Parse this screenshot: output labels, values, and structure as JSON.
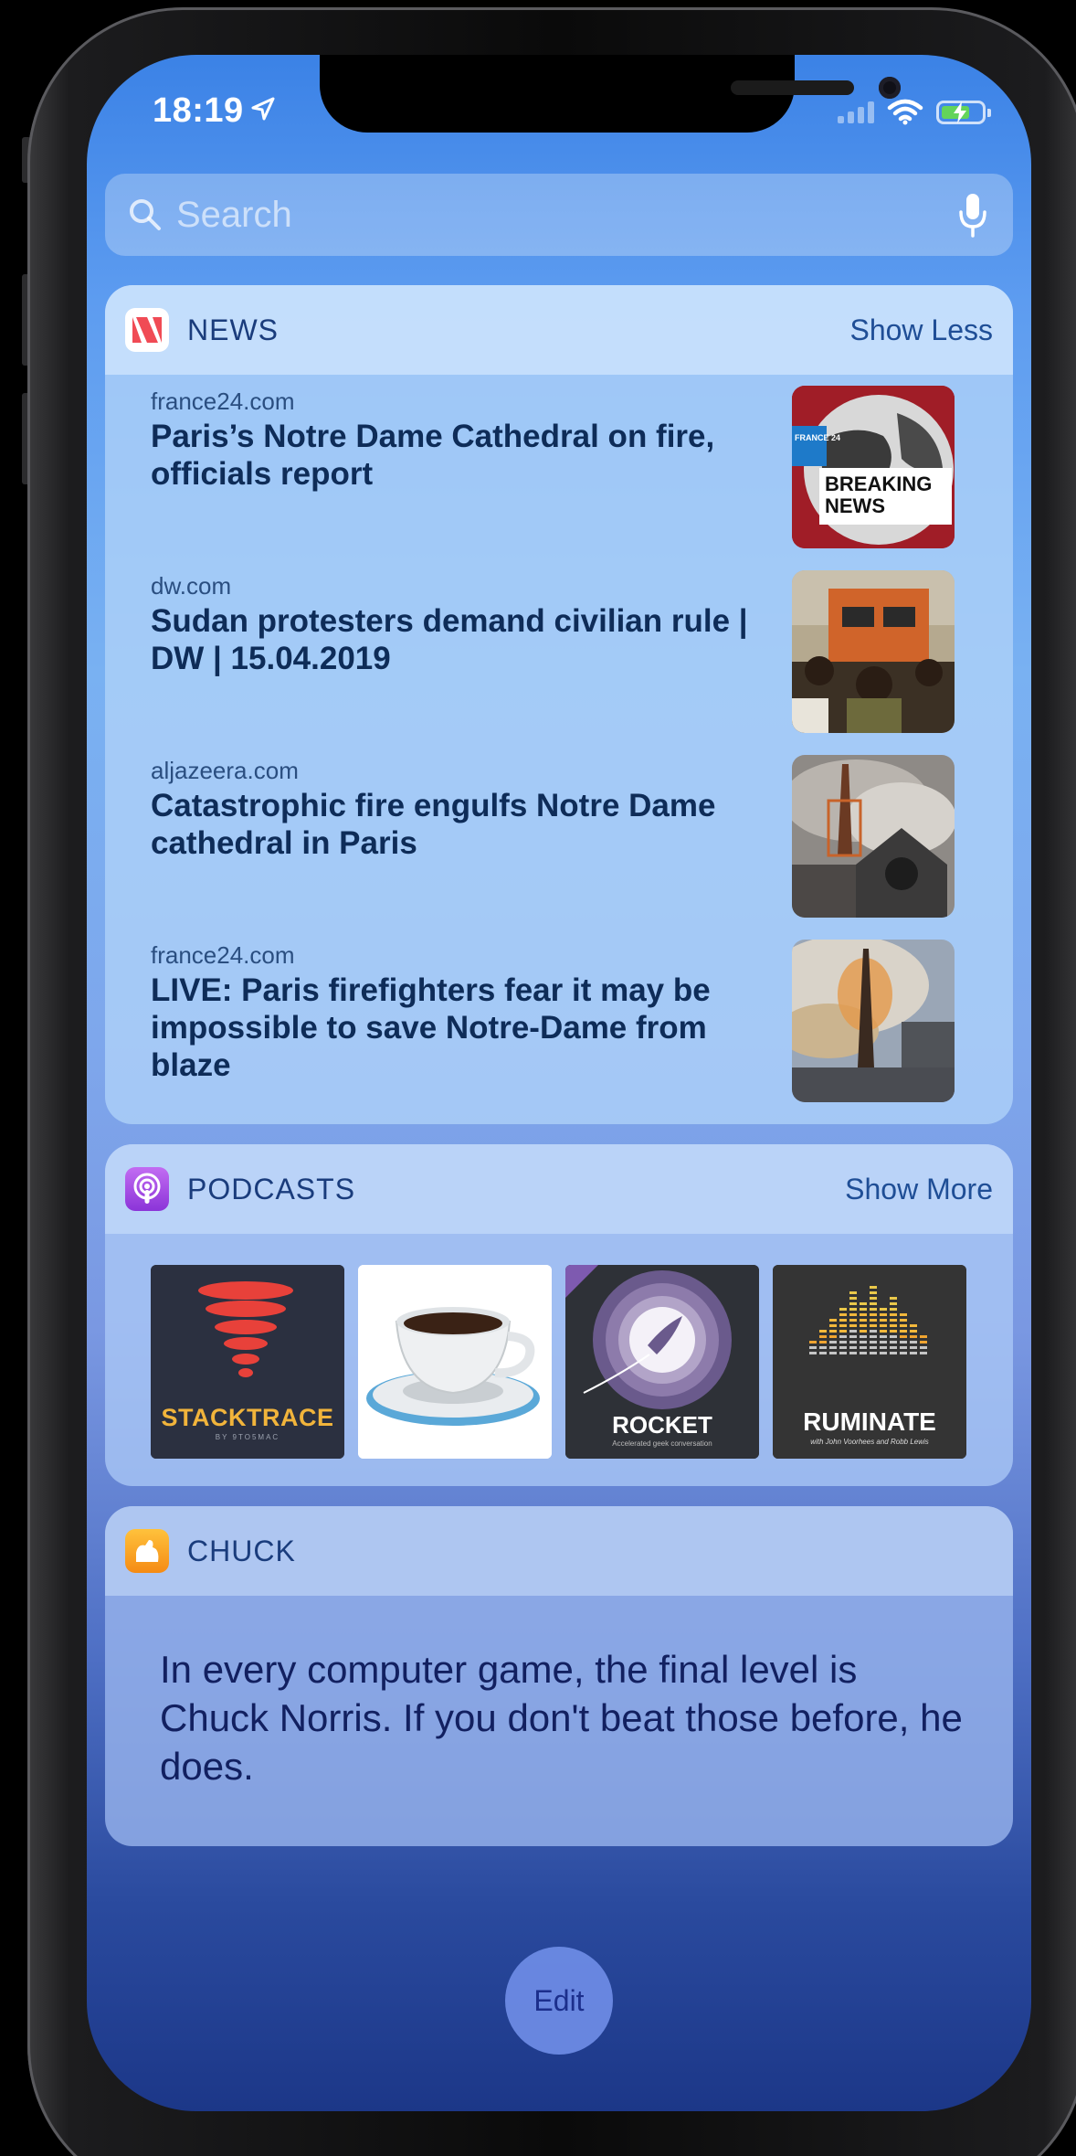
{
  "status_bar": {
    "time": "18:19"
  },
  "search": {
    "placeholder": "Search"
  },
  "news": {
    "title": "NEWS",
    "action": "Show Less",
    "items": [
      {
        "source": "france24.com",
        "headline": "Paris’s Notre Dame Cathedral on fire, officials report",
        "thumb": "breaking-news-globe",
        "thumb_text": "BREAKING NEWS",
        "thumb_badge": "FRANCE 24"
      },
      {
        "source": "dw.com",
        "headline": "Sudan protesters demand civilian rule | DW | 15.04.2019",
        "thumb": "protesters-on-train"
      },
      {
        "source": "aljazeera.com",
        "headline": "Catastrophic fire engulfs Notre Dame cathedral in Paris",
        "thumb": "cathedral-smoke"
      },
      {
        "source": "france24.com",
        "headline": "LIVE: Paris firefighters fear it may be impossible to save Notre-Dame from blaze",
        "thumb": "spire-fire"
      }
    ]
  },
  "podcasts": {
    "title": "PODCASTS",
    "action": "Show More",
    "items": [
      {
        "name": "STACKTRACE",
        "subtitle": "BY 9TO5MAC",
        "art": "stacktrace"
      },
      {
        "name": "",
        "art": "coffee-cup"
      },
      {
        "name": "ROCKET",
        "subtitle": "Accelerated geek conversation",
        "art": "rocket"
      },
      {
        "name": "RUMINATE",
        "subtitle": "with John Voorhees and Robb Lewis",
        "art": "ruminate"
      }
    ]
  },
  "chuck": {
    "title": "CHUCK",
    "joke": "In every computer game, the final level is Chuck Norris. If you don't beat those before, he does."
  },
  "edit_label": "Edit",
  "colors": {
    "accent": "#1f4e96",
    "news_icon": "#f04b55",
    "podcast_icon": "#a64fe0",
    "chuck_icon": "#f7a11a"
  }
}
